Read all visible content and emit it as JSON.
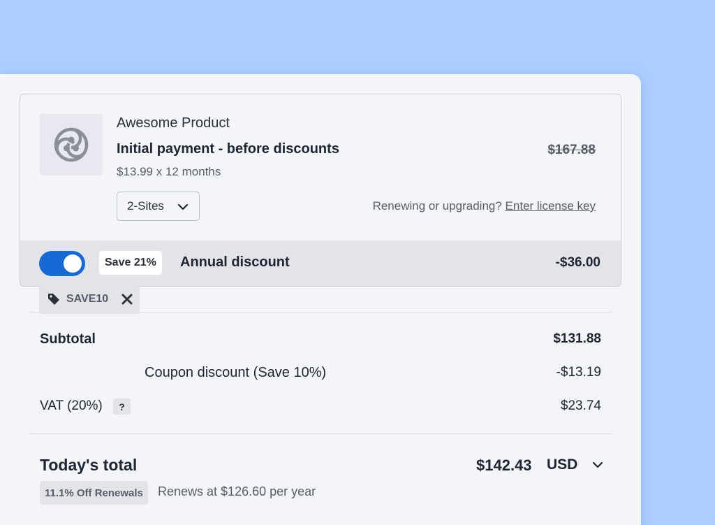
{
  "product": {
    "name": "Awesome Product",
    "payment_title": "Initial payment - before discounts",
    "price_detail": "$13.99 x 12 months",
    "original_price": "$167.88",
    "logo_icon": "triskelion-logo-icon"
  },
  "sites_select": {
    "value": "2-Sites",
    "icon": "chevron-down-icon"
  },
  "renewal_link": {
    "prefix": "Renewing or upgrading?",
    "link_text": "Enter license key"
  },
  "annual_discount": {
    "toggle_on": true,
    "save_badge": "Save 21%",
    "label": "Annual discount",
    "amount": "-$36.00",
    "accent_color": "#1769d6"
  },
  "summary": {
    "subtotal_label": "Subtotal",
    "subtotal_value": "$131.88",
    "coupon_code": "SAVE10",
    "coupon_label": "Coupon discount (Save 10%)",
    "coupon_value": "-$13.19",
    "vat_label": "VAT (20%)",
    "vat_help": "?",
    "vat_value": "$23.74"
  },
  "total": {
    "label": "Today's total",
    "amount": "$142.43",
    "currency": "USD",
    "renewal_badge": "11.1% Off Renewals",
    "renews_text": "Renews at $126.60 per year"
  }
}
